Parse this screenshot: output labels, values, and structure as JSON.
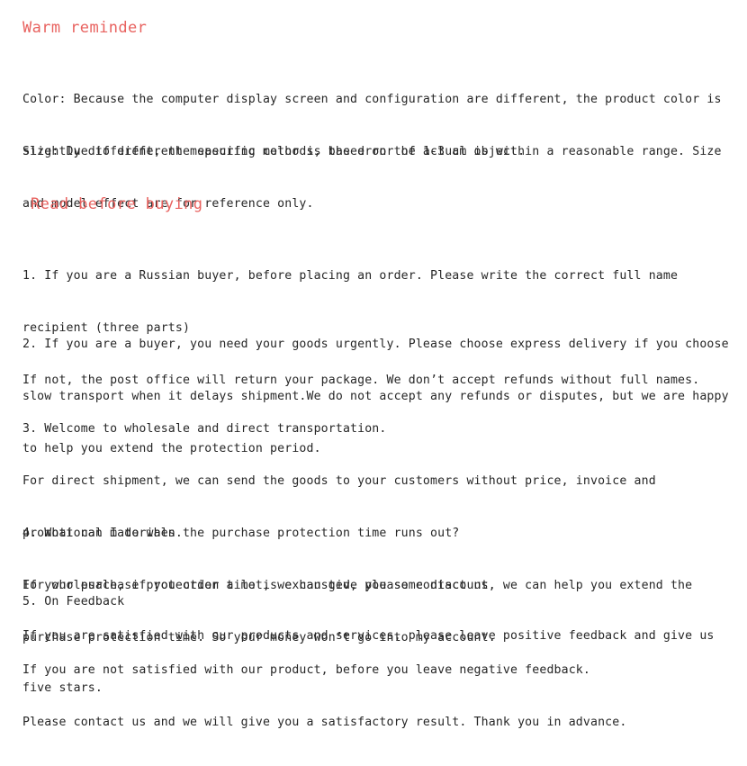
{
  "document": {
    "background_color": "#ffffff",
    "body_text_color": "#262626",
    "heading_color": "#e8625f"
  },
  "sections": {
    "warm_reminder": {
      "heading": "Warm reminder",
      "color_note": {
        "lines": [
          "Color: Because the computer display screen and configuration are different, the product color is",
          "slightly different, the specific color is based on the actual object."
        ]
      },
      "size_note": {
        "lines": [
          "Size: Due to different measuring methods, the error of 1-3 cm is within a reasonable range. Size",
          "and model effect are for reference only."
        ]
      }
    },
    "read_before_buying": {
      "heading": "Read before buying",
      "items": [
        {
          "number": "1.",
          "lines": [
            "1. If you are a Russian buyer, before placing an order. Please write the correct full name",
            "recipient (three parts)",
            "If not, the post office will return your package. We don’t accept refunds without full names."
          ]
        },
        {
          "number": "2.",
          "lines": [
            "2. If you are a buyer, you need your goods urgently. Please choose express delivery if you choose",
            "slow transport when it delays shipment.We do not accept any refunds or disputes, but we are happy",
            "to help you extend the protection period."
          ]
        },
        {
          "number": "3.",
          "lines": [
            "3. Welcome to wholesale and direct transportation.",
            "For direct shipment, we can send the goods to your customers without price, invoice and",
            "promotional materials.",
            "For wholesale, if you order a lot, we can give you some discount."
          ]
        },
        {
          "number": "4.",
          "lines": [
            "4. What can I do when the purchase protection time runs out?",
            "If your purchase protection time is exhausted, please contact us, we can help you extend the",
            "purchase protection time. So your money won’t go into my account."
          ]
        },
        {
          "number": "5.",
          "heading_line": "5. On Feedback",
          "lines_a": [
            "If you are satisfied with our products and services, please leave positive feedback and give us",
            "five stars."
          ],
          "lines_b": [
            "If you are not satisfied with our product, before you leave negative feedback.",
            "Please contact us and we will give you a satisfactory result. Thank you in advance."
          ]
        }
      ]
    }
  }
}
